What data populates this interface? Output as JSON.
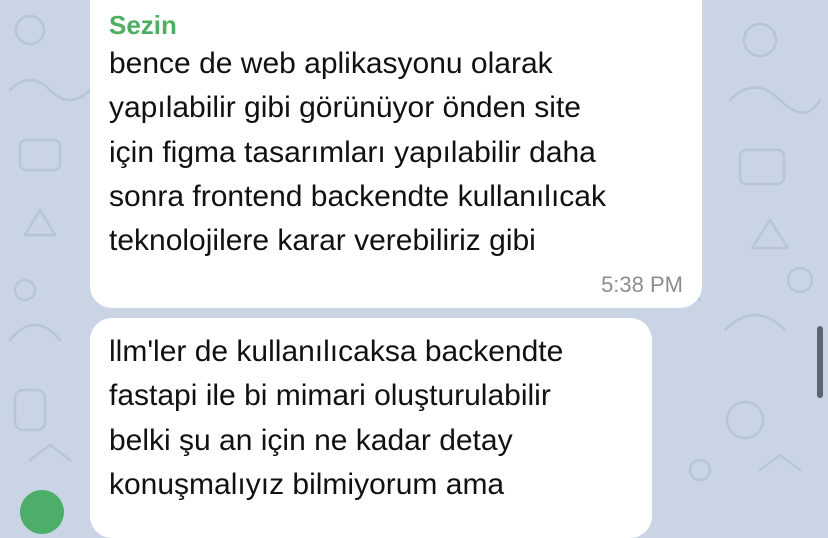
{
  "theme": {
    "background": "#c9d5e4",
    "bubble": "#ffffff",
    "sender_color": "#4fae62",
    "time_color": "#8a8e93",
    "avatar_color": "#4cae68"
  },
  "messages": [
    {
      "sender": "Sezin",
      "text": "bence de web aplikasyonu olarak\nyapılabilir gibi görünüyor önden site\niçin figma tasarımları yapılabilir daha\nsonra frontend backendte kullanılıcak\nteknolojilere karar verebiliriz gibi",
      "time": "5:38 PM"
    },
    {
      "text": "llm'ler de kullanılıcaksa backendte\nfastapi ile bi mimari oluşturulabilir\nbelki şu an için ne kadar detay\nkonuşmalıyız bilmiyorum ama"
    }
  ]
}
